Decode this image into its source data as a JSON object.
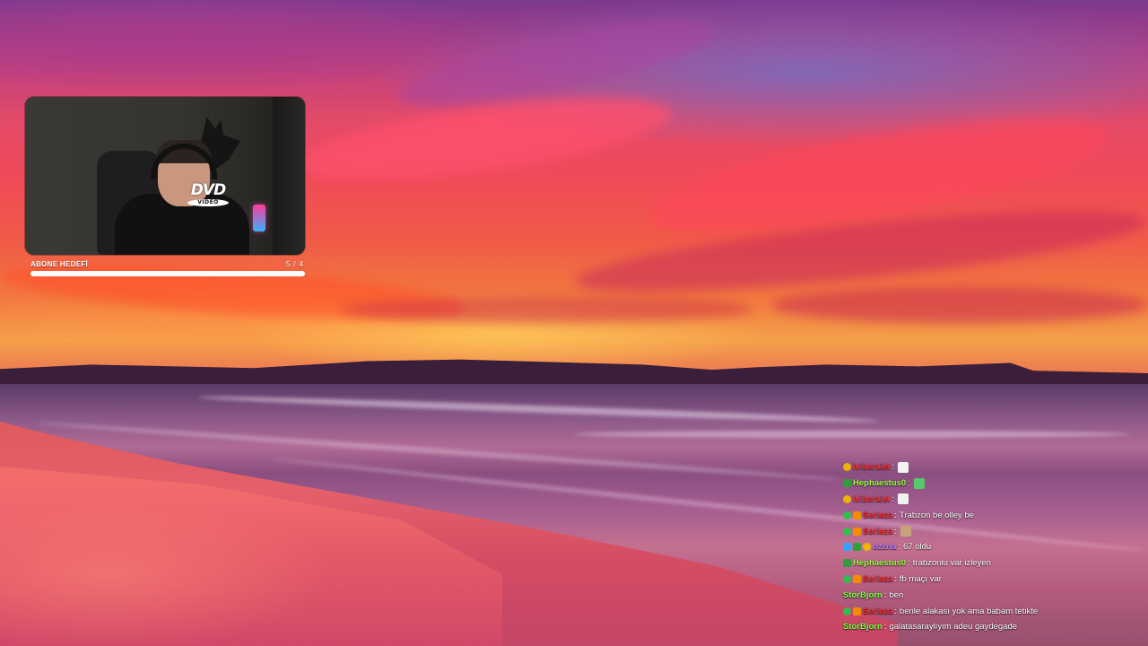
{
  "overlay": {
    "goal_label": "ABONE HEDEFİ",
    "goal_current": "5",
    "goal_separator": "/",
    "goal_target": "4",
    "goal_progress": 1.0
  },
  "webcam": {
    "dvd_logo": "DVD",
    "dvd_sub": "VIDEO"
  },
  "chat": {
    "messages": [
      {
        "user": "iviberaiel",
        "user_color": "#ff3030",
        "badges": [
          "gold-coin"
        ],
        "sep": ":",
        "text": "",
        "emote": "white-emote"
      },
      {
        "user": "Hephaestus0",
        "user_color": "#9dff47",
        "badges": [
          "green-arrow"
        ],
        "sep": ":",
        "text": "",
        "emote": "green-emote"
      },
      {
        "user": "iviberaiel",
        "user_color": "#ff3030",
        "badges": [
          "gold-coin"
        ],
        "sep": ":",
        "text": "",
        "emote": "white-emote"
      },
      {
        "user": "Serieza",
        "user_color": "#ff2a2a",
        "badges": [
          "mod-check",
          "sub-badge"
        ],
        "sep": ":",
        "text": "Trabzon be olley be",
        "emote": ""
      },
      {
        "user": "Serieza",
        "user_color": "#ff2a2a",
        "badges": [
          "mod-check",
          "sub-badge"
        ],
        "sep": ":",
        "text": "",
        "emote": "face-emote"
      },
      {
        "user": "ozzna",
        "user_color": "#b77bff",
        "badges": [
          "blue-badge",
          "green-arrow",
          "gold-coin"
        ],
        "sep": ":",
        "text": "67 oldu",
        "emote": ""
      },
      {
        "user": "Hephaestus0",
        "user_color": "#9dff47",
        "badges": [
          "green-arrow"
        ],
        "sep": ":",
        "text": "trabzonlu var izleyen",
        "emote": ""
      },
      {
        "user": "Serieza",
        "user_color": "#ff2a2a",
        "badges": [
          "mod-check",
          "sub-badge"
        ],
        "sep": ":",
        "text": "fb maçı var",
        "emote": ""
      },
      {
        "user": "StorBjorn",
        "user_color": "#7dff4a",
        "badges": [],
        "sep": ":",
        "text": "ben",
        "emote": ""
      },
      {
        "user": "Serieza",
        "user_color": "#ff2a2a",
        "badges": [
          "mod-check",
          "sub-badge"
        ],
        "sep": ":",
        "text": "benle alakası yok ama babam tetikte",
        "emote": ""
      },
      {
        "user": "StorBjorn",
        "user_color": "#7dff4a",
        "badges": [],
        "sep": ":",
        "text": "galatasaraylıyım adeu gaydegade",
        "emote": ""
      }
    ]
  },
  "colors": {
    "gold-coin": "#f0b400",
    "green-arrow": "#2f9e3c",
    "mod-check": "#2fbf4a",
    "sub-badge": "#f28c00",
    "blue-badge": "#3aa0ff",
    "white-emote": "#f2f2f2",
    "green-emote": "#56c96a",
    "face-emote": "#c8a27a"
  }
}
